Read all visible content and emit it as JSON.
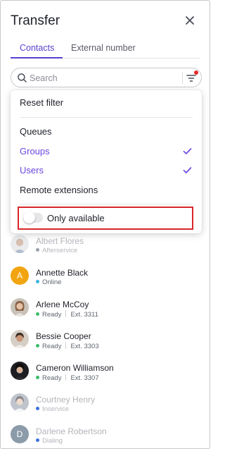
{
  "header": {
    "title": "Transfer",
    "close_icon": "close-icon"
  },
  "tabs": [
    {
      "label": "Contacts",
      "active": true
    },
    {
      "label": "External number",
      "active": false
    }
  ],
  "search": {
    "placeholder": "Search",
    "value": "",
    "filter_active": true
  },
  "filter_menu": {
    "reset_label": "Reset filter",
    "options": [
      {
        "label": "Queues",
        "selected": false
      },
      {
        "label": "Groups",
        "selected": true
      },
      {
        "label": "Users",
        "selected": true
      },
      {
        "label": "Remote extensions",
        "selected": false
      }
    ],
    "only_available": {
      "label": "Only available",
      "on": false
    }
  },
  "contacts": [
    {
      "name": "Albert Flores",
      "status": "Afterservice",
      "ext": "",
      "dimmed": true,
      "status_color": "#9aa0a8",
      "avatar": "photo"
    },
    {
      "name": "Annette Black",
      "status": "Online",
      "ext": "",
      "dimmed": false,
      "status_color": "#3cb6e0",
      "avatar": "letter",
      "initial": "A",
      "avatar_color": "#f2a511"
    },
    {
      "name": "Arlene McCoy",
      "status": "Ready",
      "ext": "Ext. 3311",
      "dimmed": false,
      "status_color": "#3dbd6e",
      "avatar": "photo"
    },
    {
      "name": "Bessie Cooper",
      "status": "Ready",
      "ext": "Ext. 3303",
      "dimmed": false,
      "status_color": "#3dbd6e",
      "avatar": "photo"
    },
    {
      "name": "Cameron Williamson",
      "status": "Ready",
      "ext": "Ext. 3307",
      "dimmed": false,
      "status_color": "#3dbd6e",
      "avatar": "photo"
    },
    {
      "name": "Courtney Henry",
      "status": "Inservice",
      "ext": "",
      "dimmed": true,
      "status_color": "#3d6fe0",
      "avatar": "photo"
    },
    {
      "name": "Darlene Robertson",
      "status": "Dialing",
      "ext": "",
      "dimmed": true,
      "status_color": "#3d6fe0",
      "avatar": "letter",
      "initial": "D",
      "avatar_color": "#2f4b63"
    }
  ],
  "colors": {
    "accent": "#5b3fd6",
    "highlight_border": "#d8262b"
  }
}
